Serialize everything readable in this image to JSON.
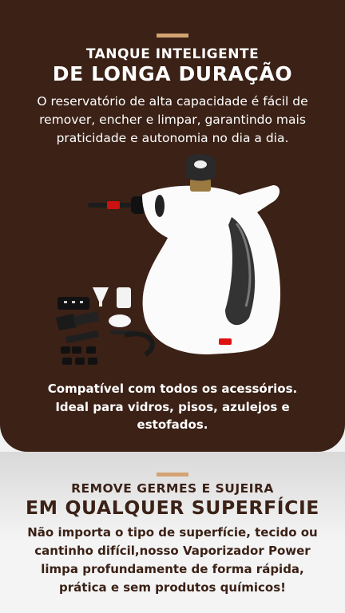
{
  "colors": {
    "top_background": "#3b2116",
    "accent_bar": "#d4a373",
    "bottom_text": "#3b2116"
  },
  "section_top": {
    "kicker": "TANQUE INTELIGENTE",
    "headline": "DE LONGA DURAÇÃO",
    "body": "O reservatório de alta capacidade é fácil de remover, encher e limpar, garantindo mais praticidade e autonomia no dia a dia.",
    "caption": "Compatível com todos os acessórios. Ideal para vidros, pisos, azulejos e estofados."
  },
  "section_bottom": {
    "kicker": "REMOVE GERMES E SUJEIRA",
    "headline": "EM QUALQUER SUPERFÍCIE",
    "body": "Não importa o tipo de superfície, tecido ou cantinho difícil,nosso Vaporizador Power limpa profundamente de forma rápida, prática e sem produtos químicos!"
  },
  "product_image": {
    "icon": "handheld-steam-cleaner-with-accessories"
  }
}
